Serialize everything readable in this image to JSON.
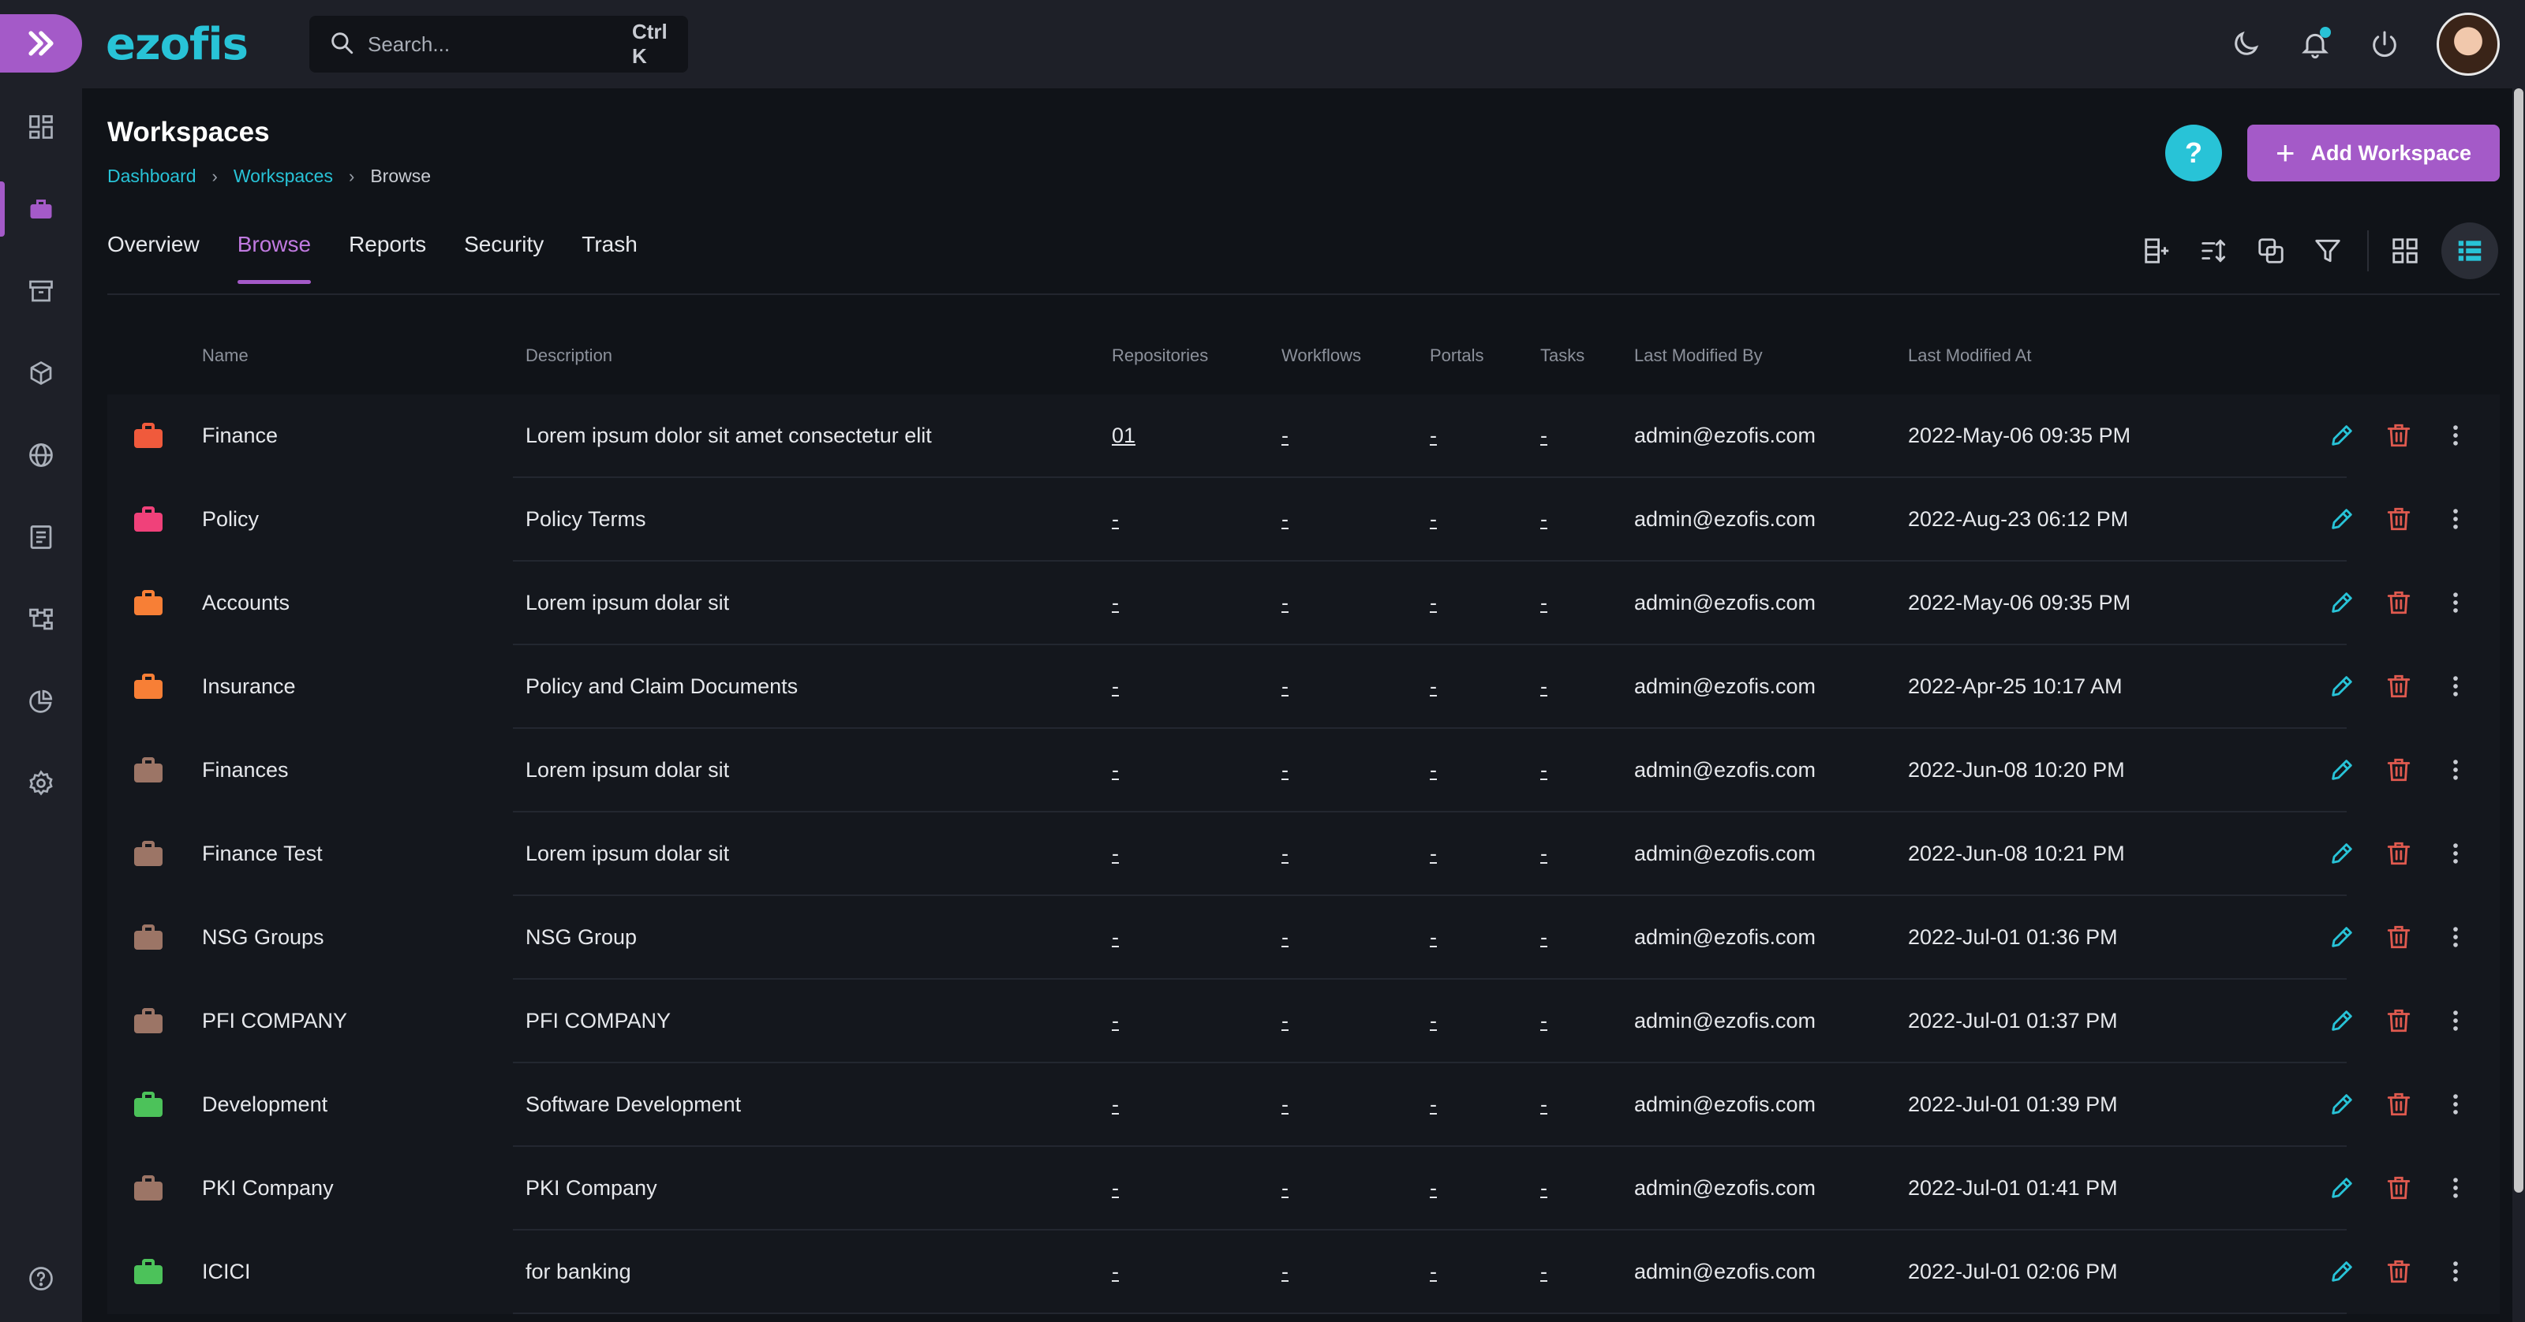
{
  "app": {
    "logo": "ezofis"
  },
  "search": {
    "placeholder": "Search...",
    "shortcut": "Ctrl K"
  },
  "colors": {
    "accent": "#a45ac8",
    "brand": "#28c3d7",
    "delete": "#e05a4f"
  },
  "page": {
    "title": "Workspaces",
    "breadcrumb": [
      "Dashboard",
      "Workspaces",
      "Browse"
    ],
    "help_label": "?",
    "add_button": "Add Workspace"
  },
  "tabs": [
    {
      "label": "Overview",
      "active": false
    },
    {
      "label": "Browse",
      "active": true
    },
    {
      "label": "Reports",
      "active": false
    },
    {
      "label": "Security",
      "active": false
    },
    {
      "label": "Trash",
      "active": false
    }
  ],
  "toolbar_icons": [
    "add-column-icon",
    "sort-icon",
    "group-icon",
    "filter-icon",
    "grid-view-icon",
    "list-view-icon"
  ],
  "sidebar_icons": [
    "dashboard-icon",
    "briefcase-icon",
    "archive-icon",
    "cube-icon",
    "globe-icon",
    "document-icon",
    "workflow-icon",
    "pie-chart-icon",
    "settings-icon",
    "help-icon"
  ],
  "table": {
    "columns": [
      "Name",
      "Description",
      "Repositories",
      "Workflows",
      "Portals",
      "Tasks",
      "Last Modified By",
      "Last Modified At"
    ],
    "rows": [
      {
        "color": "#f05a3c",
        "name": "Finance",
        "description": "Lorem ipsum dolor sit amet consectetur elit",
        "repositories": "01",
        "workflows": "-",
        "portals": "-",
        "tasks": "-",
        "modified_by": "admin@ezofis.com",
        "modified_at": "2022-May-06 09:35 PM"
      },
      {
        "color": "#f0417a",
        "name": "Policy",
        "description": "Policy Terms",
        "repositories": "-",
        "workflows": "-",
        "portals": "-",
        "tasks": "-",
        "modified_by": "admin@ezofis.com",
        "modified_at": "2022-Aug-23 06:12 PM"
      },
      {
        "color": "#f77f36",
        "name": "Accounts",
        "description": "Lorem ipsum dolar sit",
        "repositories": "-",
        "workflows": "-",
        "portals": "-",
        "tasks": "-",
        "modified_by": "admin@ezofis.com",
        "modified_at": "2022-May-06 09:35 PM"
      },
      {
        "color": "#f77f36",
        "name": "Insurance",
        "description": "Policy and Claim Documents",
        "repositories": "-",
        "workflows": "-",
        "portals": "-",
        "tasks": "-",
        "modified_by": "admin@ezofis.com",
        "modified_at": "2022-Apr-25 10:17 AM"
      },
      {
        "color": "#9c7566",
        "name": "Finances",
        "description": "Lorem ipsum dolar sit",
        "repositories": "-",
        "workflows": "-",
        "portals": "-",
        "tasks": "-",
        "modified_by": "admin@ezofis.com",
        "modified_at": "2022-Jun-08 10:20 PM"
      },
      {
        "color": "#9c7566",
        "name": "Finance Test",
        "description": "Lorem ipsum dolar sit",
        "repositories": "-",
        "workflows": "-",
        "portals": "-",
        "tasks": "-",
        "modified_by": "admin@ezofis.com",
        "modified_at": "2022-Jun-08 10:21 PM"
      },
      {
        "color": "#9c7566",
        "name": "NSG Groups",
        "description": "NSG Group",
        "repositories": "-",
        "workflows": "-",
        "portals": "-",
        "tasks": "-",
        "modified_by": "admin@ezofis.com",
        "modified_at": "2022-Jul-01 01:36 PM"
      },
      {
        "color": "#9c7566",
        "name": "PFI COMPANY",
        "description": "PFI COMPANY",
        "repositories": "-",
        "workflows": "-",
        "portals": "-",
        "tasks": "-",
        "modified_by": "admin@ezofis.com",
        "modified_at": "2022-Jul-01 01:37 PM"
      },
      {
        "color": "#4cc25a",
        "name": "Development",
        "description": "Software Development",
        "repositories": "-",
        "workflows": "-",
        "portals": "-",
        "tasks": "-",
        "modified_by": "admin@ezofis.com",
        "modified_at": "2022-Jul-01 01:39 PM"
      },
      {
        "color": "#9c7566",
        "name": "PKI Company",
        "description": "PKI Company",
        "repositories": "-",
        "workflows": "-",
        "portals": "-",
        "tasks": "-",
        "modified_by": "admin@ezofis.com",
        "modified_at": "2022-Jul-01 01:41 PM"
      },
      {
        "color": "#4cc25a",
        "name": "ICICI",
        "description": "for banking",
        "repositories": "-",
        "workflows": "-",
        "portals": "-",
        "tasks": "-",
        "modified_by": "admin@ezofis.com",
        "modified_at": "2022-Jul-01 02:06 PM"
      }
    ]
  }
}
